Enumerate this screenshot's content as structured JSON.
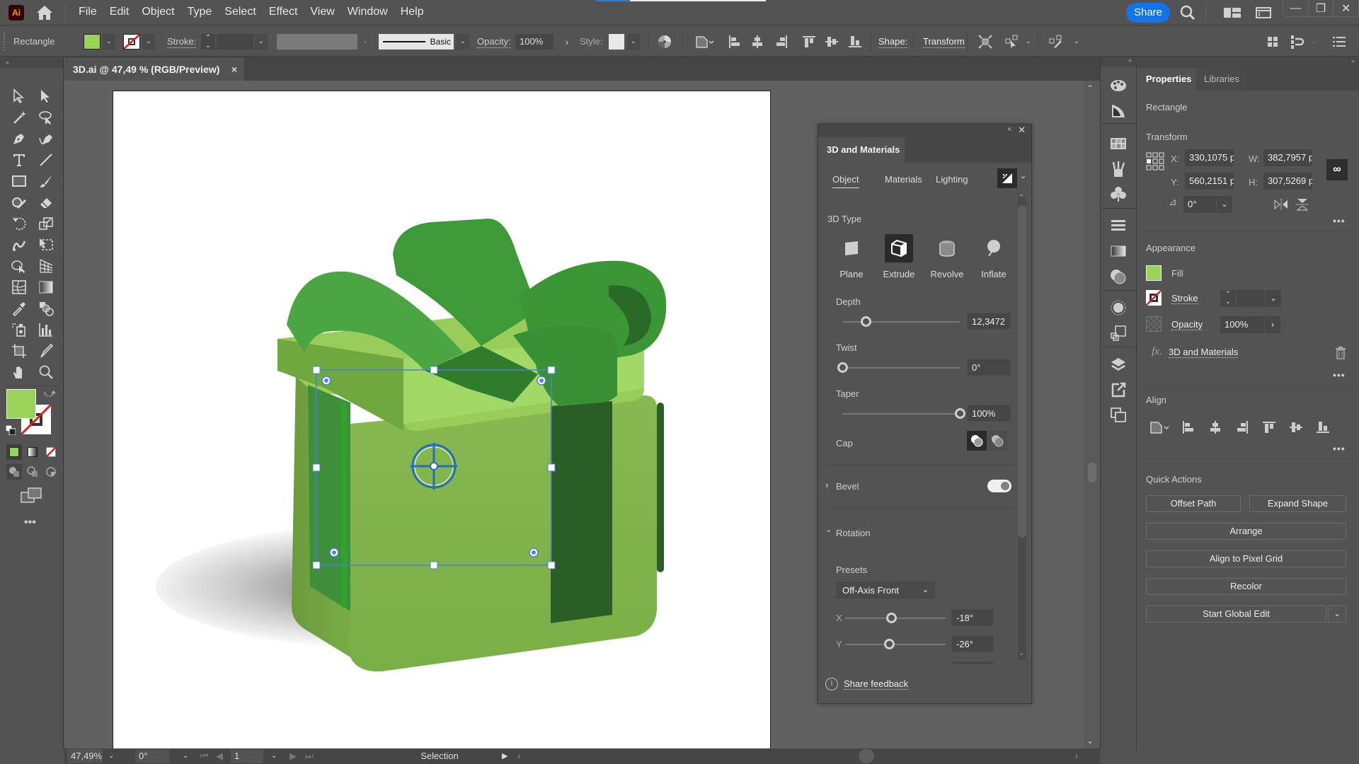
{
  "app": {
    "logo": "Ai",
    "menu": [
      "File",
      "Edit",
      "Object",
      "Type",
      "Select",
      "Effect",
      "View",
      "Window",
      "Help"
    ],
    "share_label": "Share",
    "progress_fraction": 0.2
  },
  "controlbar": {
    "object_type": "Rectangle",
    "fill_color": "#9bd35a",
    "stroke_label": "Stroke:",
    "stroke_weight": "",
    "brush_label": "Basic",
    "opacity_label": "Opacity:",
    "opacity_value": "100%",
    "style_label": "Style:",
    "shape_label": "Shape:",
    "transform_label": "Transform"
  },
  "document": {
    "tab_title": "3D.ai @ 47,49 % (RGB/Preview)",
    "close_glyph": "×"
  },
  "status": {
    "zoom": "47,49%",
    "rotation": "0°",
    "artboard": "1",
    "tool": "Selection"
  },
  "panel3d": {
    "title": "3D and Materials",
    "tabs": [
      "Object",
      "Materials",
      "Lighting"
    ],
    "active_tab": "Object",
    "type_label": "3D Type",
    "types": [
      "Plane",
      "Extrude",
      "Revolve",
      "Inflate"
    ],
    "active_type": "Extrude",
    "depth_label": "Depth",
    "depth_value": "12,3472",
    "depth_fraction": 0.2,
    "twist_label": "Twist",
    "twist_value": "0°",
    "twist_fraction": 0.0,
    "taper_label": "Taper",
    "taper_value": "100%",
    "taper_fraction": 1.0,
    "cap_label": "Cap",
    "bevel_label": "Bevel",
    "bevel_on": true,
    "rotation_label": "Rotation",
    "presets_label": "Presets",
    "preset_value": "Off-Axis Front",
    "x_label": "X",
    "x_value": "-18°",
    "y_label": "Y",
    "y_value": "-26°",
    "feedback_label": "Share feedback"
  },
  "properties": {
    "tabs": [
      "Properties",
      "Libraries"
    ],
    "object_type": "Rectangle",
    "transform_label": "Transform",
    "x_label": "X:",
    "x_value": "330,1075 p",
    "y_label": "Y:",
    "y_value": "560,2151 p",
    "w_label": "W:",
    "w_value": "382,7957 p",
    "h_label": "H:",
    "h_value": "307,5269 p",
    "angle_value": "0°",
    "appearance_label": "Appearance",
    "fill_label": "Fill",
    "fill_color": "#9bd35a",
    "stroke_label": "Stroke",
    "opacity_label": "Opacity",
    "opacity_value": "100%",
    "effect_label": "3D and Materials",
    "align_label": "Align",
    "quick_actions_label": "Quick Actions",
    "quick_actions": [
      "Offset Path",
      "Expand Shape",
      "Arrange",
      "Align to Pixel Grid",
      "Recolor",
      "Start Global Edit"
    ]
  }
}
